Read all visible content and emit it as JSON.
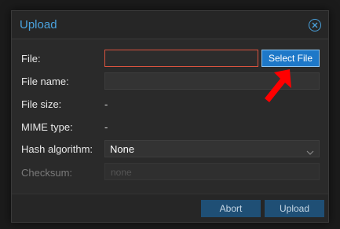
{
  "dialog": {
    "title": "Upload",
    "close_icon": "close-circle-icon"
  },
  "form": {
    "file_label": "File:",
    "select_file_label": "Select File",
    "file_name_label": "File name:",
    "file_size_label": "File size:",
    "file_size_value": "-",
    "mime_type_label": "MIME type:",
    "mime_type_value": "-",
    "hash_algorithm_label": "Hash algorithm:",
    "hash_algorithm_value": "None",
    "checksum_label": "Checksum:",
    "checksum_placeholder": "none"
  },
  "footer": {
    "abort_label": "Abort",
    "upload_label": "Upload"
  },
  "annotation": {
    "arrow_icon": "red-arrow-icon",
    "arrow_color": "#ff0000"
  },
  "colors": {
    "accent": "#4aa3df",
    "invalid_border": "#d9533f",
    "primary_button": "#1e78c8"
  }
}
